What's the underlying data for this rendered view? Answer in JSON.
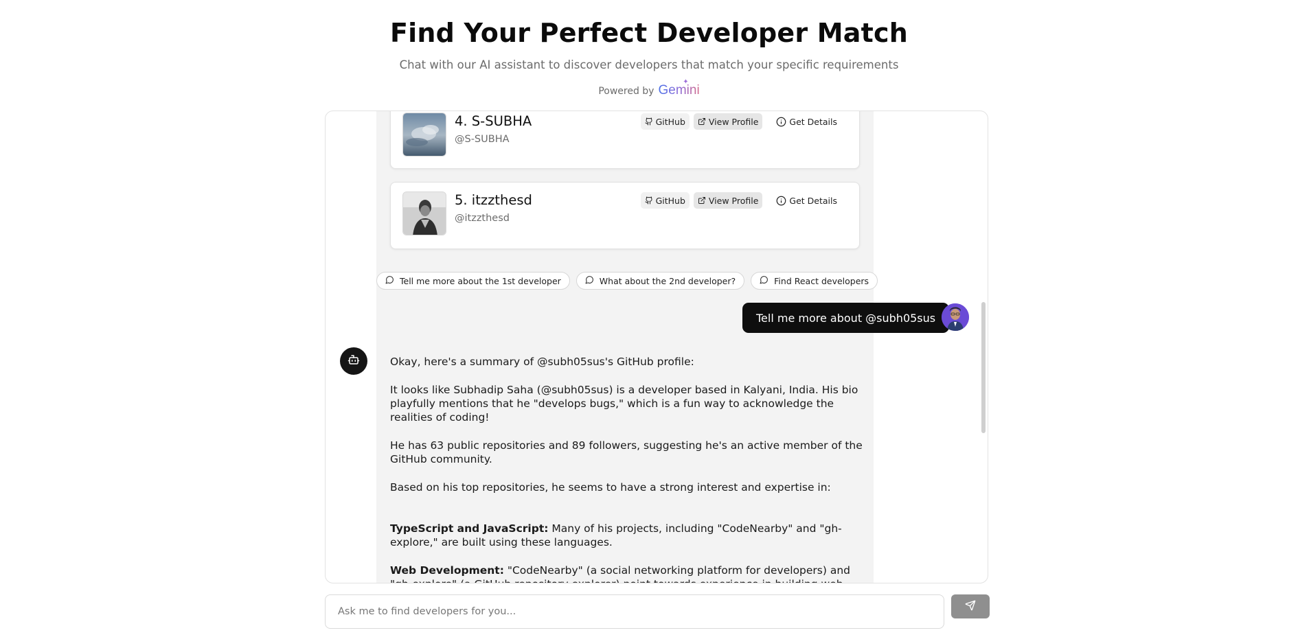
{
  "header": {
    "title": "Find Your Perfect Developer Match",
    "subtitle": "Chat with our AI assistant to discover developers that match your specific requirements",
    "powered_by": "Powered by",
    "brand": "Gemini"
  },
  "results": [
    {
      "name": "4. S-SUBHA",
      "handle": "@S-SUBHA",
      "github_label": "GitHub",
      "view_label": "View Profile",
      "details_label": "Get Details"
    },
    {
      "name": "5. itzzthesd",
      "handle": "@itzzthesd",
      "github_label": "GitHub",
      "view_label": "View Profile",
      "details_label": "Get Details"
    }
  ],
  "suggestions": [
    "Tell me more about the 1st developer",
    "What about the 2nd developer?",
    "Find React developers"
  ],
  "user_message": "Tell me more about @subh05sus",
  "bot_message": {
    "p1": "Okay, here's a summary of @subh05sus's GitHub profile:",
    "p2": "It looks like Subhadip Saha (@subh05sus) is a developer based in Kalyani, India. His bio playfully mentions that he \"develops bugs,\" which is a fun way to acknowledge the realities of coding!",
    "p3": "He has 63 public repositories and 89 followers, suggesting he's an active member of the GitHub community.",
    "p4": "Based on his top repositories, he seems to have a strong interest and expertise in:",
    "p5_bold": "TypeScript and JavaScript:",
    "p5_text": " Many of his projects, including \"CodeNearby\" and \"gh-explore,\" are built using these languages.",
    "p6_bold": "Web Development:",
    "p6_text": " \"CodeNearby\" (a social networking platform for developers) and \"gh-explore\" (a GitHub repository explorer) point towards experience in building web applications."
  },
  "input": {
    "placeholder": "Ask me to find developers for you...",
    "value": ""
  },
  "icons": {
    "github": "github-icon",
    "external": "external-link-icon",
    "info": "info-icon",
    "chat": "message-circle-icon",
    "bot": "bot-icon",
    "send": "send-icon"
  },
  "colors": {
    "primary": "#0e0e0e",
    "bubble_bg": "#f3f3f3",
    "send_disabled": "#8f8f8f",
    "user_avatar": "#6a4bd6"
  }
}
